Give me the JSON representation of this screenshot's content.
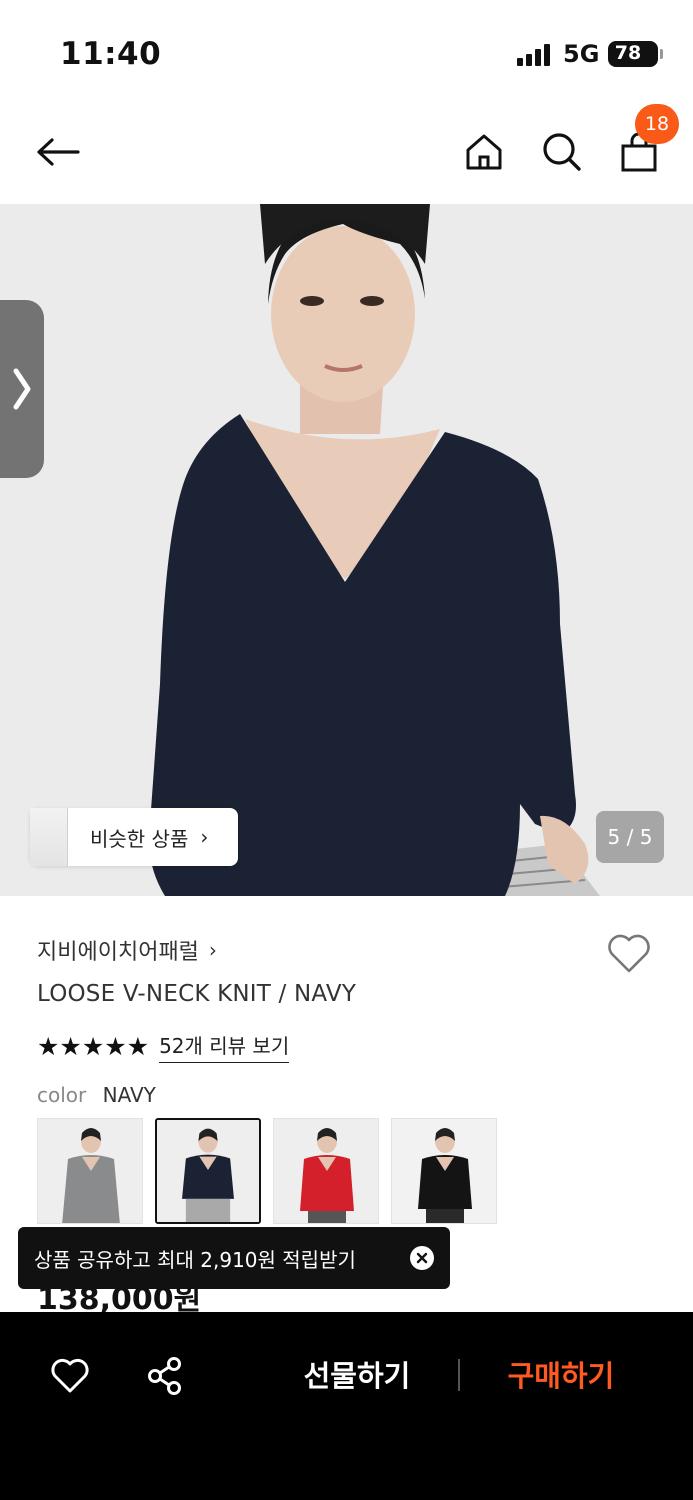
{
  "status_bar": {
    "time": "11:40",
    "network": "5G",
    "battery": "78"
  },
  "nav": {
    "cart_count": "18",
    "icons": [
      "back-arrow-icon",
      "home-icon",
      "search-icon",
      "shopping-bag-icon"
    ]
  },
  "hero": {
    "similar_label": "비슷한 상품",
    "chevron": "›",
    "page_indicator": "5 / 5"
  },
  "product": {
    "brand": "지비에이치어패럴",
    "brand_chevron": "›",
    "title": "LOOSE V-NECK KNIT / NAVY",
    "stars": "★★★★★",
    "review_link": "52개 리뷰 보기",
    "color_label": "color",
    "color_value": "NAVY",
    "price_partial": "138,000원",
    "rating": 5
  },
  "swatches": [
    {
      "name": "gray",
      "color": "#8a8b8d",
      "selected": false
    },
    {
      "name": "navy",
      "color": "#1b2233",
      "selected": true
    },
    {
      "name": "red",
      "color": "#d3202b",
      "selected": false
    },
    {
      "name": "black",
      "color": "#141414",
      "selected": false
    }
  ],
  "toast": {
    "text": "상품 공유하고 최대 2,910원 적립받기"
  },
  "bottom_bar": {
    "gift_label": "선물하기",
    "buy_label": "구매하기",
    "accent_color": "#ff5a1f"
  }
}
